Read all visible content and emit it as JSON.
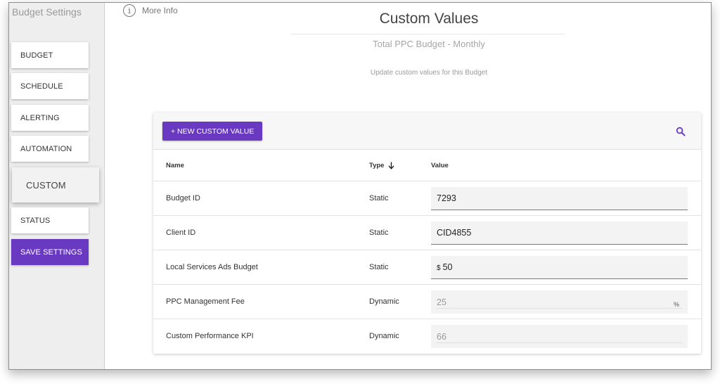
{
  "sidebar": {
    "title": "Budget Settings",
    "items": [
      {
        "label": "BUDGET"
      },
      {
        "label": "SCHEDULE"
      },
      {
        "label": "ALERTING"
      },
      {
        "label": "AUTOMATION"
      },
      {
        "label": "CUSTOM",
        "active": true
      },
      {
        "label": "STATUS"
      }
    ],
    "save_label": "SAVE SETTINGS"
  },
  "header": {
    "more_info": "More Info",
    "info_icon": "info-circle-icon",
    "title": "Custom Values",
    "subtitle": "Total PPC Budget - Monthly",
    "description": "Update custom values for this Budget"
  },
  "card": {
    "new_button": "+ NEW CUSTOM VALUE",
    "search_icon": "search-icon",
    "columns": {
      "name": "Name",
      "type": "Type",
      "value": "Value",
      "sort_icon": "arrow-down-icon"
    },
    "rows": [
      {
        "name": "Budget ID",
        "type": "Static",
        "value": "7293",
        "prefix": "",
        "suffix": "",
        "editable": true
      },
      {
        "name": "Client ID",
        "type": "Static",
        "value": "CID4855",
        "prefix": "",
        "suffix": "",
        "editable": true
      },
      {
        "name": "Local Services Ads Budget",
        "type": "Static",
        "value": "50",
        "prefix": "$",
        "suffix": "",
        "editable": true
      },
      {
        "name": "PPC Management Fee",
        "type": "Dynamic",
        "value": "25",
        "prefix": "",
        "suffix": "%",
        "editable": false
      },
      {
        "name": "Custom Performance KPI",
        "type": "Dynamic",
        "value": "66",
        "prefix": "",
        "suffix": "",
        "editable": false
      }
    ]
  },
  "colors": {
    "accent": "#6a39c2",
    "sidebar_bg": "#eeeeee",
    "field_bg": "#f3f3f3"
  }
}
